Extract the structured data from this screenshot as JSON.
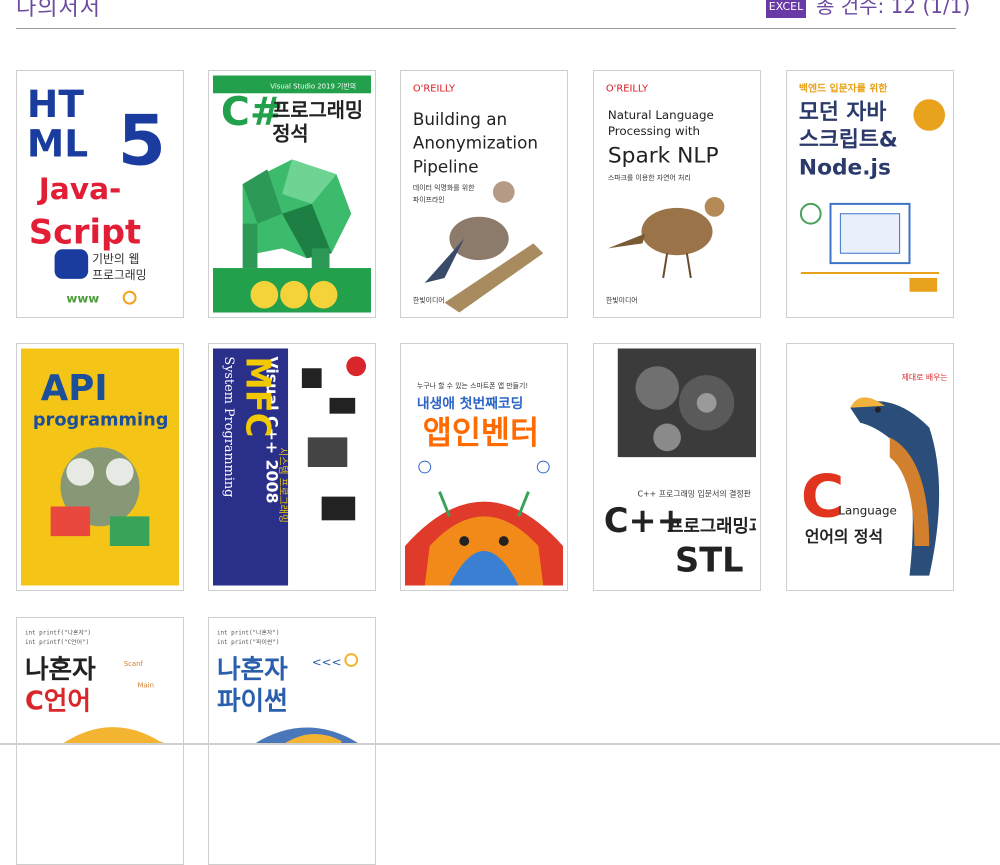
{
  "header": {
    "title": "다의서서",
    "excel_label": "EXCEL",
    "count_text": "총 건수: 12 (1/1)"
  },
  "books": [
    {
      "id": "html5-js",
      "lines": [
        "HT",
        "ML",
        "5",
        "Java-",
        "Script",
        "기반의 웹",
        "프로그래밍"
      ],
      "colors": [
        "#1a3c9e",
        "#e21e36"
      ]
    },
    {
      "id": "csharp",
      "lines": [
        "Visual Studio 2019 기반의",
        "C#",
        "프로그래밍",
        "정석"
      ],
      "colors": [
        "#22a04b",
        "#ffffff"
      ]
    },
    {
      "id": "anon-pipeline",
      "lines": [
        "O'REILLY",
        "Building an",
        "Anonymization",
        "Pipeline",
        "데이터 익명화를 위한",
        "파이프라인"
      ],
      "colors": [
        "#ffffff",
        "#d71920"
      ]
    },
    {
      "id": "spark-nlp",
      "lines": [
        "O'REILLY",
        "Natural Language",
        "Processing with",
        "Spark NLP",
        "스파크를 이용한 자연어 처리"
      ],
      "colors": [
        "#ffffff",
        "#d71920"
      ]
    },
    {
      "id": "modern-js",
      "lines": [
        "백엔드 입문자를 위한",
        "모던 자바",
        "스크립트&",
        "Node.js"
      ],
      "colors": [
        "#2b4a9b",
        "#e8a21b"
      ]
    },
    {
      "id": "api-programming",
      "lines": [
        "API",
        "programming"
      ],
      "colors": [
        "#f4c516",
        "#1b4f9a"
      ]
    },
    {
      "id": "mfc",
      "lines": [
        "Visual C++ 2008",
        "MFC",
        "System Programming",
        "시스템 프로그래밍"
      ],
      "colors": [
        "#2a2f8a",
        "#f2c900"
      ]
    },
    {
      "id": "app-inventor",
      "lines": [
        "누구나 할 수 있는 스마트폰 앱 만들기!",
        "내생애 첫번째코딩",
        "앱인벤터"
      ],
      "colors": [
        "#ff6b00",
        "#2d66c7"
      ]
    },
    {
      "id": "cpp-stl",
      "lines": [
        "C++ 프로그래밍 입문서의 결정판",
        "C++",
        "프로그래밍과",
        "STL"
      ],
      "colors": [
        "#222222",
        "#ffffff"
      ]
    },
    {
      "id": "c-lang",
      "lines": [
        "제대로 배우는 C언어",
        "C",
        "Language",
        "언어의 정석"
      ],
      "colors": [
        "#e0341e",
        "#222222"
      ]
    },
    {
      "id": "honja-c",
      "lines": [
        "나혼자",
        "C언어"
      ],
      "colors": [
        "#d9262b",
        "#f3b431"
      ]
    },
    {
      "id": "honja-python",
      "lines": [
        "나혼자",
        "파이썬"
      ],
      "colors": [
        "#2a5fae",
        "#f3b431"
      ]
    }
  ]
}
